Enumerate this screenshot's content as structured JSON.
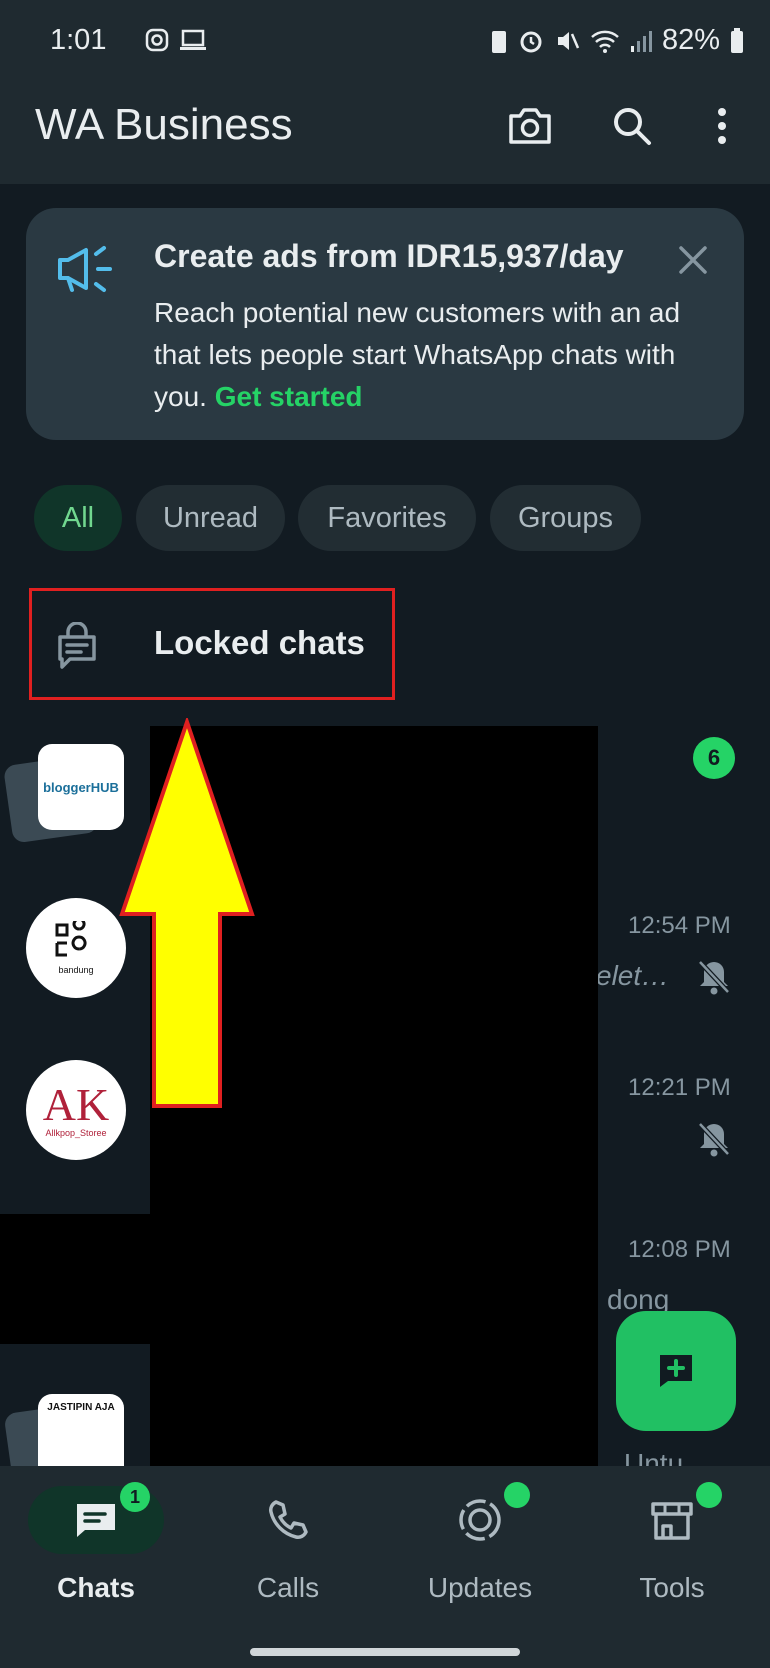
{
  "status_bar": {
    "time": "1:01",
    "battery": "82%"
  },
  "header": {
    "title": "WA Business"
  },
  "banner": {
    "title": "Create ads from IDR15,937/day",
    "body": "Reach potential new customers with an ad that lets people start WhatsApp chats with you.",
    "link": "Get started"
  },
  "filters": [
    {
      "label": "All",
      "active": true
    },
    {
      "label": "Unread"
    },
    {
      "label": "Favorites"
    },
    {
      "label": "Groups"
    }
  ],
  "locked": {
    "label": "Locked chats"
  },
  "chats": [
    {
      "avatar_text": "bloggerHUB",
      "unread": "6"
    },
    {
      "avatar_text": "bandung",
      "time": "12:54 PM",
      "preview": "elet…"
    },
    {
      "avatar_text": "Allkpop_Storee",
      "time": "12:21 PM"
    },
    {
      "time": "12:08 PM",
      "preview": "dong"
    },
    {
      "avatar_text": "JASTIPIN AJA",
      "preview": "Untu"
    }
  ],
  "nav": [
    {
      "label": "Chats",
      "badge": "1",
      "active": true
    },
    {
      "label": "Calls"
    },
    {
      "label": "Updates"
    },
    {
      "label": "Tools"
    }
  ],
  "colors": {
    "accent": "#25d366",
    "highlight": "#e02020",
    "arrow": "#ffff00"
  }
}
